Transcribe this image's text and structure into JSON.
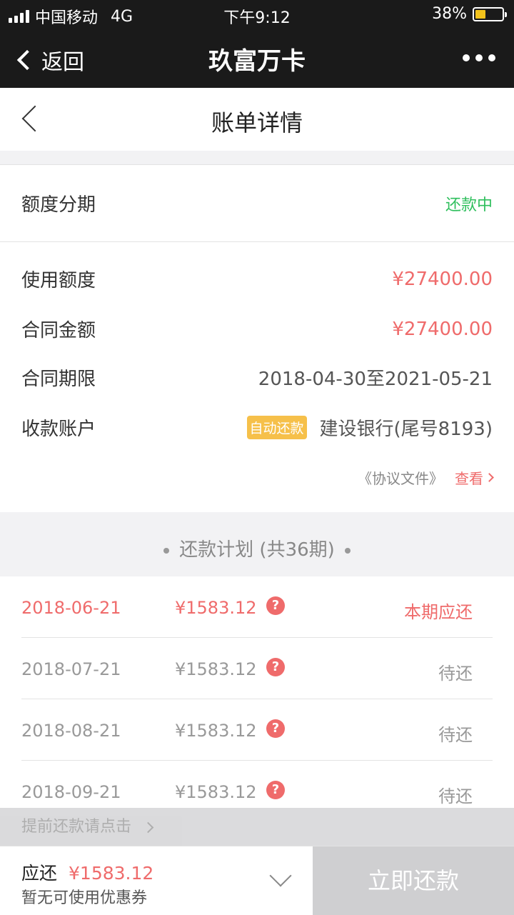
{
  "statusbar": {
    "carrier": "中国移动",
    "network": "4G",
    "time": "下午9:12",
    "battery": "38%",
    "battery_level": 0.38
  },
  "navbar": {
    "back_label": "返回",
    "title": "玖富万卡"
  },
  "page": {
    "title": "账单详情"
  },
  "loan": {
    "type": "额度分期",
    "status": "还款中",
    "fields": [
      {
        "label": "使用额度",
        "value": "¥27400.00"
      },
      {
        "label": "合同金额",
        "value": "¥27400.00"
      },
      {
        "label": "合同期限",
        "value": "2018-04-30至2021-05-21"
      },
      {
        "label": "收款账户",
        "tag": "自动还款",
        "value": "建设银行(尾号8193)"
      }
    ],
    "agreement_label": "《协议文件》",
    "view_label": "查看"
  },
  "plan": {
    "title": "还款计划 (共36期)",
    "rows": [
      {
        "date": "2018-06-21",
        "amount": "¥1583.12",
        "status": "本期应还"
      },
      {
        "date": "2018-07-21",
        "amount": "¥1583.12",
        "status": "待还"
      },
      {
        "date": "2018-08-21",
        "amount": "¥1583.12",
        "status": "待还"
      },
      {
        "date": "2018-09-21",
        "amount": "¥1583.12",
        "status": "待还"
      }
    ]
  },
  "prepay_label": "提前还款请点击",
  "footer": {
    "due_label": "应还",
    "due_amount": "¥1583.12",
    "coupon": "暂无可使用优惠券",
    "pay_button": "立即还款"
  },
  "colors": {
    "accent_red": "#ef6b6b",
    "status_green": "#2fbf5d",
    "tag_yellow": "#f6c04a"
  }
}
